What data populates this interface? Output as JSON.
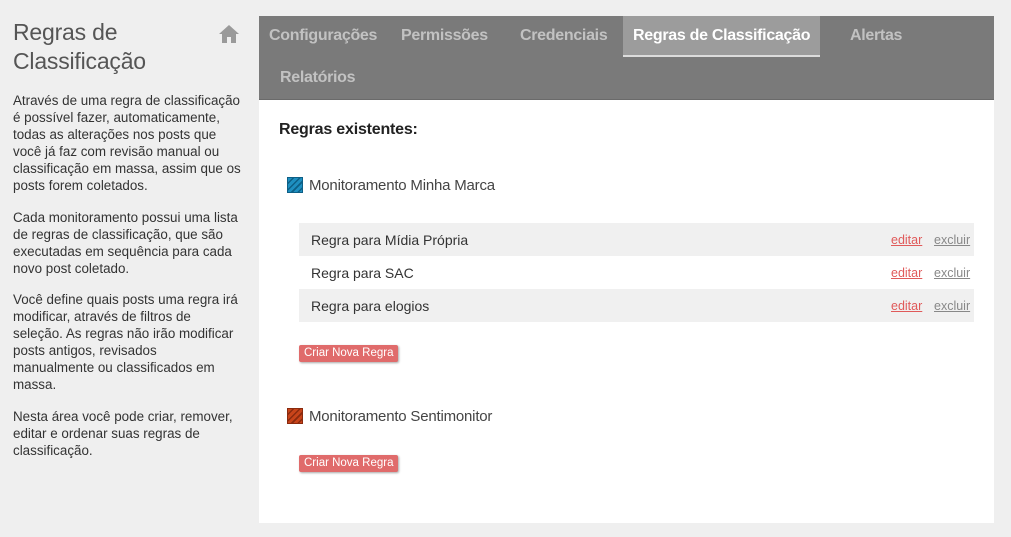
{
  "sidebar": {
    "title": "Regras de Classificação",
    "home_icon": "home-icon",
    "paragraphs": [
      "Através de uma regra de classificação é possível fazer, automaticamente, todas as alterações nos posts que você já faz com revisão manual ou classificação em massa, assim que os posts forem coletados.",
      "Cada monitoramento possui uma lista de regras de classificação, que são executadas em sequência para cada novo post coletado.",
      "Você define quais posts uma regra irá modificar, através de filtros de seleção. As regras não irão modificar posts antigos, revisados manualmente ou classificados em massa.",
      "Nesta área você pode criar, remover, editar e ordenar suas regras de classificação."
    ]
  },
  "tabs": [
    {
      "label": "Configurações",
      "active": false
    },
    {
      "label": "Permissões",
      "active": false
    },
    {
      "label": "Credenciais",
      "active": false
    },
    {
      "label": "Regras de Classificação",
      "active": true
    },
    {
      "label": "Alertas",
      "active": false
    },
    {
      "label": "Relatórios",
      "active": false
    }
  ],
  "main": {
    "heading": "Regras existentes:",
    "groups": [
      {
        "name": "Monitoramento Minha Marca",
        "color": "#1e8fc0",
        "rules": [
          {
            "name": "Regra para Mídia Própria",
            "edit": "editar",
            "delete": "excluir"
          },
          {
            "name": "Regra para SAC",
            "edit": "editar",
            "delete": "excluir"
          },
          {
            "name": "Regra para elogios",
            "edit": "editar",
            "delete": "excluir"
          }
        ],
        "new_rule_label": "Criar Nova Regra"
      },
      {
        "name": "Monitoramento Sentimonitor",
        "color": "#c8441a",
        "rules": [],
        "new_rule_label": "Criar Nova Regra"
      }
    ]
  },
  "colors": {
    "tab_bar": "#7a7a7a",
    "tab_active": "#9c9c9c",
    "edit_link": "#e05a5a",
    "button": "#e06b6b"
  }
}
